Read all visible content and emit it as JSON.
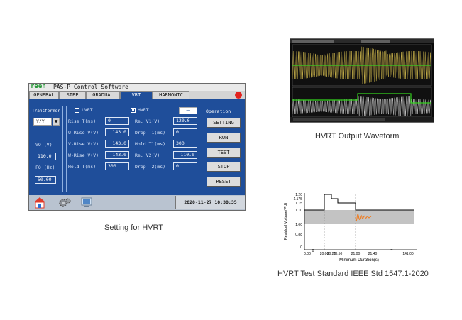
{
  "hmi": {
    "brand": "reen",
    "title": "PAS-P Control Software",
    "tabs": [
      "GENERAL",
      "STEP",
      "GRADUAL",
      "VRT",
      "HARMONIC"
    ],
    "active_tab": "VRT",
    "transformer": {
      "label": "Transformer",
      "value": "Y/Y",
      "vo_label": "VO  (V)",
      "vo_value": "110.0",
      "fo_label": "FO  (Hz)",
      "fo_value": "50.00"
    },
    "lvrt_label": "LVRT",
    "hvrt_label": "HVRT",
    "hvrt_checked": true,
    "lvrt_checked": false,
    "arrow_button": "→",
    "rise": {
      "rise_t_label": "Rise  T(ms)",
      "rise_t_value": "0",
      "u_rise_label": "U-Rise V(V)",
      "u_rise_value": "143.0",
      "v_rise_label": "V-Rise V(V)",
      "v_rise_value": "143.0",
      "w_rise_label": "W-Rise V(V)",
      "w_rise_value": "143.0",
      "hold_t_label": "Hold T(ms)",
      "hold_t_value": "300"
    },
    "recover": {
      "re_v1_label": "Re. V1(V)",
      "re_v1_value": "120.0",
      "drop_t1_label": "Drop T1(ms)",
      "drop_t1_value": "0",
      "hold_t1_label": "Hold T1(ms)",
      "hold_t1_value": "300",
      "re_v2_label": "Re. V2(V)",
      "re_v2_value": "110.0",
      "drop_t2_label": "Drop T2(ms)",
      "drop_t2_value": "0"
    },
    "operation": {
      "label": "Operation",
      "buttons": [
        "SETTING",
        "RUN",
        "TEST",
        "STOP",
        "RESET"
      ]
    },
    "datetime": "2020-11-27 10:30:35"
  },
  "captions": {
    "hmi": "Setting for HVRT",
    "scope": "HVRT Output Waveform",
    "chart": "HVRT Test Standard IEEE Std 1547.1-2020"
  },
  "chart_data": {
    "type": "line",
    "ylabel": "Residual Voltage(PU)",
    "xlabel": "Minimum Duration(s)",
    "y_ticks": [
      "1.20",
      "1.175",
      "1.15",
      "1.10",
      "1.00",
      "0.88",
      "0"
    ],
    "x_ticks": [
      "0.00",
      "20.00",
      "20.20",
      "20.50",
      "21.00",
      "21.40",
      "141.00"
    ],
    "x_break_label": "0",
    "colors": {
      "step": "#000000",
      "band": "#bdbdbd",
      "oscillation": "#f07a1c"
    }
  }
}
